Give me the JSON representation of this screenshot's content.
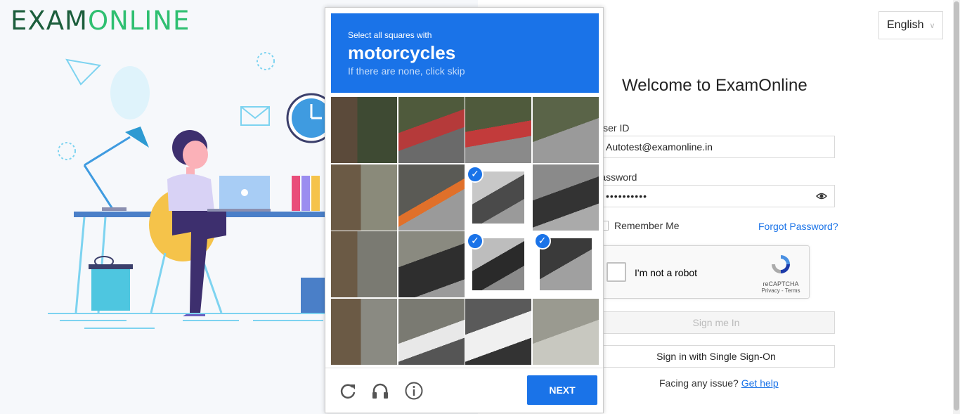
{
  "logo": {
    "part1": "EXAM",
    "part2": "ONLINE"
  },
  "language": {
    "selected": "English"
  },
  "welcome_title": "Welcome to ExamOnline",
  "form": {
    "user_id_label": "User ID",
    "user_id_value": "Autotest@examonline.in",
    "password_label": "Password",
    "password_value": "••••••••••",
    "remember_label": "Remember Me",
    "forgot_label": "Forgot Password?",
    "signin_label": "Sign me In",
    "sso_label": "Sign in with Single Sign-On",
    "issue_text": "Facing any issue?",
    "help_link": "Get help"
  },
  "recaptcha": {
    "checkbox_label": "I'm not a robot",
    "brand": "reCAPTCHA",
    "links": "Privacy - Terms"
  },
  "challenge": {
    "instruction": "Select all squares with",
    "target": "motorcycles",
    "hint": "If there are none, click skip",
    "tiles": [
      {
        "selected": false
      },
      {
        "selected": false
      },
      {
        "selected": false
      },
      {
        "selected": false
      },
      {
        "selected": false
      },
      {
        "selected": false
      },
      {
        "selected": true
      },
      {
        "selected": false
      },
      {
        "selected": false
      },
      {
        "selected": false
      },
      {
        "selected": true
      },
      {
        "selected": true
      },
      {
        "selected": false
      },
      {
        "selected": false
      },
      {
        "selected": false
      },
      {
        "selected": false
      }
    ],
    "next_label": "NEXT",
    "icons": [
      "reload-icon",
      "audio-icon",
      "info-icon"
    ]
  },
  "colors": {
    "accent": "#1a73e8",
    "logo_dark": "#1c5e3c",
    "logo_light": "#2fbf71"
  }
}
